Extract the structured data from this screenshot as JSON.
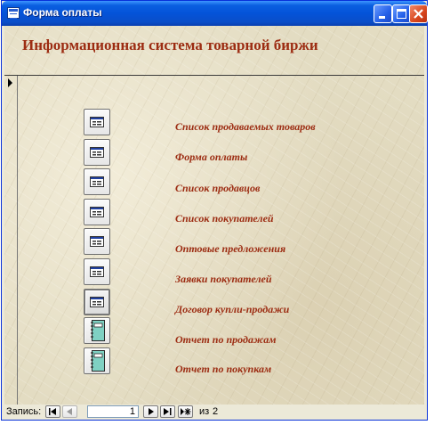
{
  "window": {
    "title": "Форма оплаты"
  },
  "form": {
    "heading": "Информационная система товарной биржи",
    "items": [
      {
        "label": "Список продаваемых товаров",
        "icon": "form-icon"
      },
      {
        "label": "Форма оплаты",
        "icon": "form-icon"
      },
      {
        "label": "Список продавцов",
        "icon": "form-icon"
      },
      {
        "label": "Список покупателей",
        "icon": "form-icon"
      },
      {
        "label": "Оптовые предложения",
        "icon": "form-icon"
      },
      {
        "label": "Заявки покупателей",
        "icon": "form-icon"
      },
      {
        "label": "Договор купли-продажи",
        "icon": "form-icon"
      },
      {
        "label": "Отчет по продажам",
        "icon": "report-icon"
      },
      {
        "label": "Отчет по покупкам",
        "icon": "report-icon"
      }
    ],
    "focused_item": "Договор купли-продажи"
  },
  "record_nav": {
    "label": "Запись:",
    "current": "1",
    "of_label": "из",
    "total": "2"
  },
  "colors": {
    "title_bar": "#0453d9",
    "heading_text": "#9c2c12",
    "item_text": "#9c2c12",
    "form_background": "#e3dcc2",
    "report_icon_fill": "#7fd1c3"
  }
}
